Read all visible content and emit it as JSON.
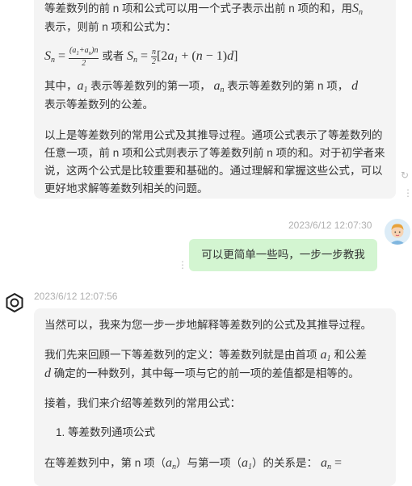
{
  "msg1": {
    "line1_a": "等差数列的前 n 项和公式可以用一个式子表示出前 n 项的和，用",
    "line2": "表示，则前 n 项和公式为：",
    "or_text": "或者",
    "explain_a": "其中，",
    "explain_b": "表示等差数列的第一项，",
    "explain_c": "表示等差数列的第 n 项，",
    "explain_d": "表示等差数列的公差。",
    "summary": "以上是等差数列的常用公式及其推导过程。通项公式表示了等差数列的任意一项，前 n 项和公式则表示了等差数列前 n 项的和。对于初学者来说，这两个公式是比较重要和基础的。通过理解和掌握这些公式，可以更好地求解等差数列相关的问题。"
  },
  "user_msg": {
    "timestamp": "2023/6/12 12:07:30",
    "text": "可以更简单一些吗，一步一步教我"
  },
  "msg2": {
    "timestamp": "2023/6/12 12:07:56",
    "intro": "当然可以，我来为您一步一步地解释等差数列的公式及其推导过程。",
    "def_a": "我们先来回顾一下等差数列的定义：等差数列就是由首项",
    "def_b": "和公差",
    "def_c": "确定的一种数列，其中每一项与它的前一项的差值都是相等的。",
    "next": "接着，我们来介绍等差数列的常用公式：",
    "list_item": "1. 等差数列通项公式",
    "last_a": "在等差数列中，第 n 项（",
    "last_b": "）与第一项（",
    "last_c": "）的关系是："
  },
  "colors": {
    "ai_bubble": "#f4f4f4",
    "user_bubble": "#d3f5d1",
    "timestamp": "#b0b0b0"
  }
}
